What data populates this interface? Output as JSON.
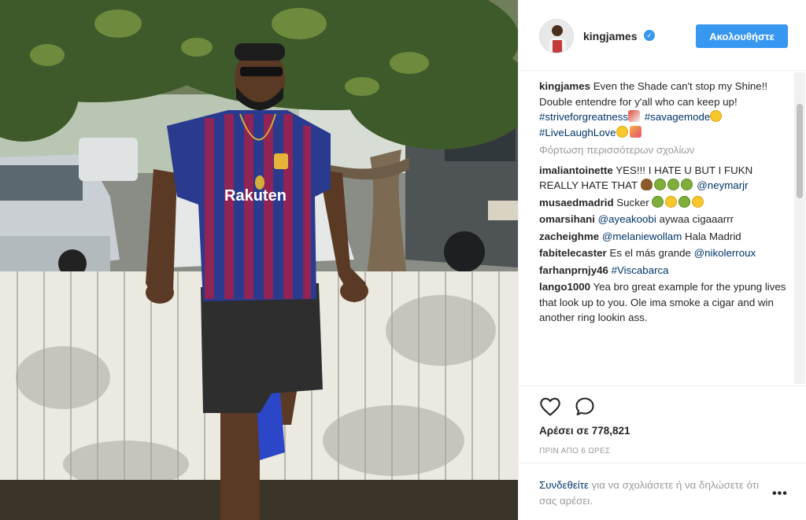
{
  "post": {
    "username": "kingjames",
    "follow_label": "Ακολουθήστε",
    "verified_icon": "✓"
  },
  "caption": {
    "user": "kingjames",
    "text": "Even the Shade can't stop my Shine!! Double entendre for y'all who can keep up!",
    "hashtags": [
      "#striveforgreatness",
      "#savagemode",
      "#LiveLaughLove"
    ]
  },
  "load_more": "Φόρτωση περισσότερων σχολίων",
  "comments": [
    {
      "user": "imaliantoinette",
      "text": "YES!!! I HATE U BUT I FUKN REALLY HATE THAT",
      "mention": "@neymarjr"
    },
    {
      "user": "musaedmadrid",
      "text": "Sucker"
    },
    {
      "user": "omarsihani",
      "mention": "@ayeakoobi",
      "text": "aywaa cigaaarrr"
    },
    {
      "user": "zacheighme",
      "mention": "@melaniewollam",
      "text": "Hala Madrid"
    },
    {
      "user": "fabitelecaster",
      "text": "Es el más grande",
      "mention": "@nikolerroux"
    },
    {
      "user": "farhanprnjy46",
      "mention": "#Viscabarca"
    },
    {
      "user": "lango1000",
      "text": "Yea bro great example for the ypung lives that look up to you. Ole ima smoke a cigar and win another ring lookin ass."
    }
  ],
  "photo": {
    "jersey_sponsor": "Rakuten"
  },
  "likes": "Αρέσει σε 778,821",
  "time": "ΠΡΙΝ ΑΠΟ 6 ΩΡΕΣ",
  "footer": {
    "login_link": "Συνδεθείτε",
    "login_rest": "για να σχολιάσετε ή να δηλώσετε ότι σας αρέσει.",
    "more": "•••"
  }
}
